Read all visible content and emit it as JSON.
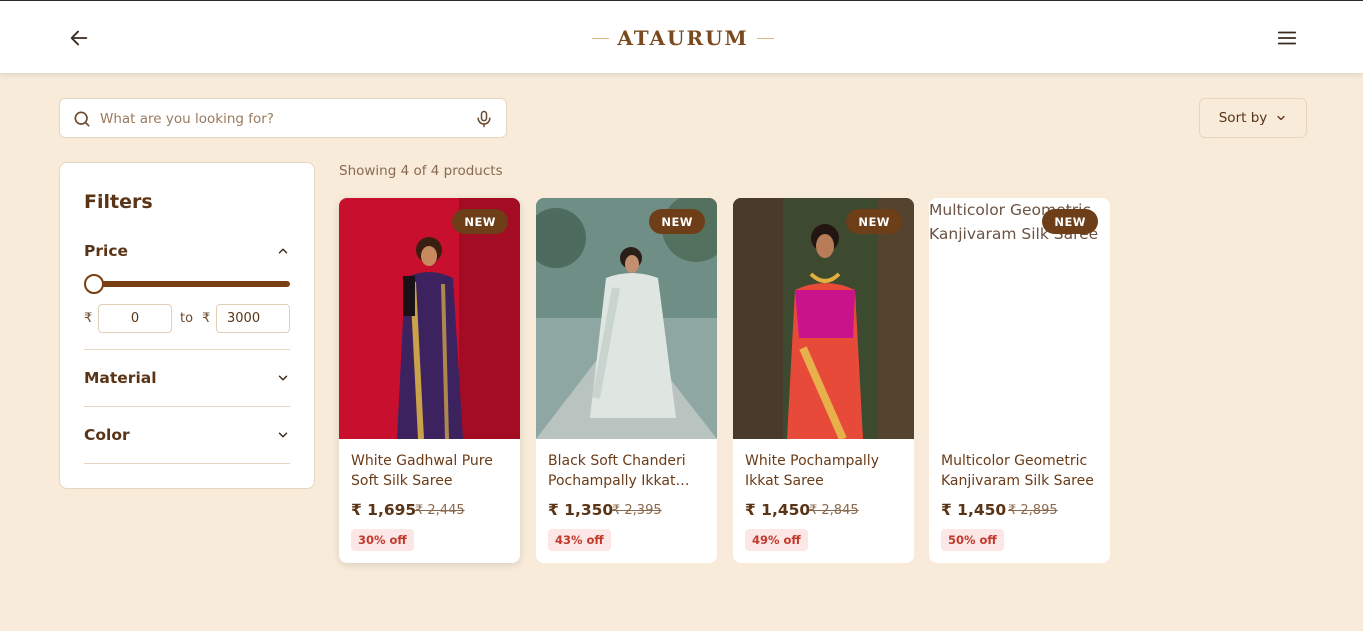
{
  "header": {
    "logo": "ATAURUM",
    "back_icon": "arrow-left-icon",
    "menu_icon": "hamburger-menu-icon"
  },
  "search": {
    "placeholder": "What are you looking for?",
    "value": "",
    "search_icon": "search-icon",
    "mic_icon": "microphone-icon"
  },
  "sort": {
    "label": "Sort by",
    "icon": "chevron-down-icon"
  },
  "filters": {
    "title": "Filters",
    "price": {
      "label": "Price",
      "currency": "₹",
      "to_label": "to",
      "min": "0",
      "max": "3000",
      "slider_level": 0.0
    },
    "material": {
      "label": "Material"
    },
    "color": {
      "label": "Color"
    }
  },
  "results": {
    "showing_text": "Showing 4 of 4 products"
  },
  "products": [
    {
      "name": "White Gadhwal Pure Soft Silk Saree",
      "price": "₹ 1,695",
      "mrp": "₹ 2,445",
      "discount": "30% off",
      "badge": "NEW"
    },
    {
      "name": "Black Soft Chanderi Pochampally Ikkat Saree",
      "price": "₹ 1,350",
      "mrp": "₹ 2,395",
      "discount": "43% off",
      "badge": "NEW"
    },
    {
      "name": "White Pochampally Ikkat Saree",
      "price": "₹ 1,450",
      "mrp": "₹ 2,845",
      "discount": "49% off",
      "badge": "NEW"
    },
    {
      "name": "Multicolor Geometric Kanjivaram Silk Saree",
      "price": "₹ 1,450",
      "mrp": "₹ 2,895",
      "discount": "50% off",
      "badge": "NEW",
      "image_alt": "Multicolor Geometric Kanjivaram Silk Saree"
    }
  ],
  "colors": {
    "brand_brown": "#7a3e13",
    "background": "#f8ebda",
    "badge": "#6d3e18",
    "discount_red": "#c0392b"
  }
}
